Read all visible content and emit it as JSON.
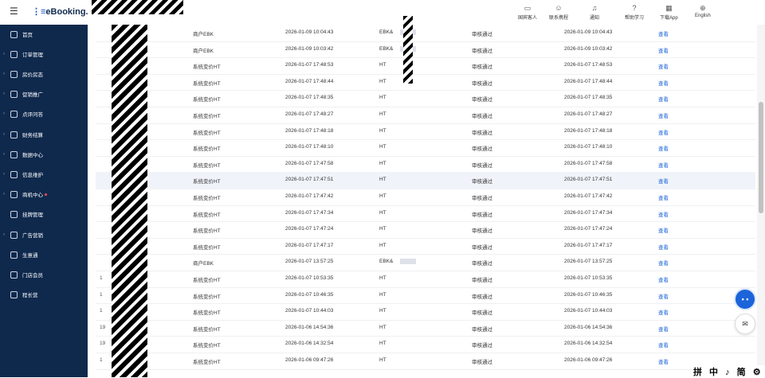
{
  "header": {
    "hamburger_icon": "menu-icon",
    "logo": "eBooking.",
    "items": [
      {
        "label": "国宾客人",
        "icon": "guest-icon"
      },
      {
        "label": "联系携程",
        "icon": "contact-icon"
      },
      {
        "label": "通知",
        "icon": "bell-icon"
      },
      {
        "label": "帮助学习",
        "icon": "help-icon"
      },
      {
        "label": "下载App",
        "icon": "qrcode-icon"
      },
      {
        "label": "English",
        "icon": "globe-icon"
      }
    ]
  },
  "sidebar": {
    "items": [
      {
        "label": "首页",
        "expandable": false
      },
      {
        "label": "订单管理",
        "expandable": true
      },
      {
        "label": "房价房态",
        "expandable": true
      },
      {
        "label": "促销推广",
        "expandable": true
      },
      {
        "label": "点评问答",
        "expandable": true
      },
      {
        "label": "财务结算",
        "expandable": true
      },
      {
        "label": "数据中心",
        "expandable": true
      },
      {
        "label": "信息维护",
        "expandable": true
      },
      {
        "label": "商机中心",
        "expandable": true,
        "dot": true
      },
      {
        "label": "挂牌管理",
        "expandable": false
      },
      {
        "label": "广告营销",
        "expandable": true
      },
      {
        "label": "生意通",
        "expandable": false
      },
      {
        "label": "门店会员",
        "expandable": false
      },
      {
        "label": "程长营",
        "expandable": false
      }
    ]
  },
  "table": {
    "rows": [
      {
        "id": "",
        "source": "商户EBK",
        "submit_time": "2026-01-09 10:04:43",
        "operator": "EBK&",
        "status": "审核通过",
        "audit_time": "2026-01-09 10:04:43",
        "action": "查看"
      },
      {
        "id": "",
        "source": "商户EBK",
        "submit_time": "2026-01-09 10:03:42",
        "operator": "EBK&",
        "status": "审核通过",
        "audit_time": "2026-01-09 10:03:42",
        "action": "查看"
      },
      {
        "id": "",
        "source": "系统变价HT",
        "submit_time": "2026-01-07 17:48:53",
        "operator": "HT",
        "status": "审核通过",
        "audit_time": "2026-01-07 17:48:53",
        "action": "查看"
      },
      {
        "id": "",
        "source": "系统变价HT",
        "submit_time": "2026-01-07 17:48:44",
        "operator": "HT",
        "status": "审核通过",
        "audit_time": "2026-01-07 17:48:44",
        "action": "查看"
      },
      {
        "id": "",
        "source": "系统变价HT",
        "submit_time": "2026-01-07 17:48:35",
        "operator": "HT",
        "status": "审核通过",
        "audit_time": "2026-01-07 17:48:35",
        "action": "查看"
      },
      {
        "id": "",
        "source": "系统变价HT",
        "submit_time": "2026-01-07 17:48:27",
        "operator": "HT",
        "status": "审核通过",
        "audit_time": "2026-01-07 17:48:27",
        "action": "查看"
      },
      {
        "id": "",
        "source": "系统变价HT",
        "submit_time": "2026-01-07 17:48:18",
        "operator": "HT",
        "status": "审核通过",
        "audit_time": "2026-01-07 17:48:18",
        "action": "查看"
      },
      {
        "id": "",
        "source": "系统变价HT",
        "submit_time": "2026-01-07 17:48:10",
        "operator": "HT",
        "status": "审核通过",
        "audit_time": "2026-01-07 17:48:10",
        "action": "查看"
      },
      {
        "id": "",
        "source": "系统变价HT",
        "submit_time": "2026-01-07 17:47:58",
        "operator": "HT",
        "status": "审核通过",
        "audit_time": "2026-01-07 17:47:58",
        "action": "查看"
      },
      {
        "id": "",
        "source": "系统变价HT",
        "submit_time": "2026-01-07 17:47:51",
        "operator": "HT",
        "status": "审核通过",
        "audit_time": "2026-01-07 17:47:51",
        "action": "查看",
        "highlight": true
      },
      {
        "id": "",
        "source": "系统变价HT",
        "submit_time": "2026-01-07 17:47:42",
        "operator": "HT",
        "status": "审核通过",
        "audit_time": "2026-01-07 17:47:42",
        "action": "查看"
      },
      {
        "id": "",
        "source": "系统变价HT",
        "submit_time": "2026-01-07 17:47:34",
        "operator": "HT",
        "status": "审核通过",
        "audit_time": "2026-01-07 17:47:34",
        "action": "查看"
      },
      {
        "id": "",
        "source": "系统变价HT",
        "submit_time": "2026-01-07 17:47:24",
        "operator": "HT",
        "status": "审核通过",
        "audit_time": "2026-01-07 17:47:24",
        "action": "查看"
      },
      {
        "id": "",
        "source": "系统变价HT",
        "submit_time": "2026-01-07 17:47:17",
        "operator": "HT",
        "status": "审核通过",
        "audit_time": "2026-01-07 17:47:17",
        "action": "查看"
      },
      {
        "id": "",
        "source": "商户EBK",
        "submit_time": "2026-01-07 13:57:25",
        "operator": "EBK&",
        "status": "审核通过",
        "audit_time": "2026-01-07 13:57:25",
        "action": "查看"
      },
      {
        "id": "1",
        "source": "系统变价HT",
        "submit_time": "2026-01-07 10:53:35",
        "operator": "HT",
        "status": "审核通过",
        "audit_time": "2026-01-07 10:53:35",
        "action": "查看"
      },
      {
        "id": "1",
        "source": "系统变价HT",
        "submit_time": "2026-01-07 10:46:35",
        "operator": "HT",
        "status": "审核通过",
        "audit_time": "2026-01-07 10:46:35",
        "action": "查看"
      },
      {
        "id": "1",
        "source": "系统变价HT",
        "submit_time": "2026-01-07 10:44:03",
        "operator": "HT",
        "status": "审核通过",
        "audit_time": "2026-01-07 10:44:03",
        "action": "查看"
      },
      {
        "id": "19",
        "source": "系统变价HT",
        "submit_time": "2026-01-06 14:54:36",
        "operator": "HT",
        "status": "审核通过",
        "audit_time": "2026-01-06 14:54:36",
        "action": "查看"
      },
      {
        "id": "19",
        "source": "系统变价HT",
        "submit_time": "2026-01-06 14:32:54",
        "operator": "HT",
        "status": "审核通过",
        "audit_time": "2026-01-06 14:32:54",
        "action": "查看"
      },
      {
        "id": "1",
        "source": "系统变价HT",
        "submit_time": "2026-01-06 09:47:26",
        "operator": "HT",
        "status": "审核通过",
        "audit_time": "2026-01-06 09:47:26",
        "action": "查看"
      }
    ]
  },
  "floating": {
    "assistant_label": "• •",
    "chat_icon": "chat-icon"
  },
  "ime_bar": "拼 中 ♪ 简 ⚙"
}
